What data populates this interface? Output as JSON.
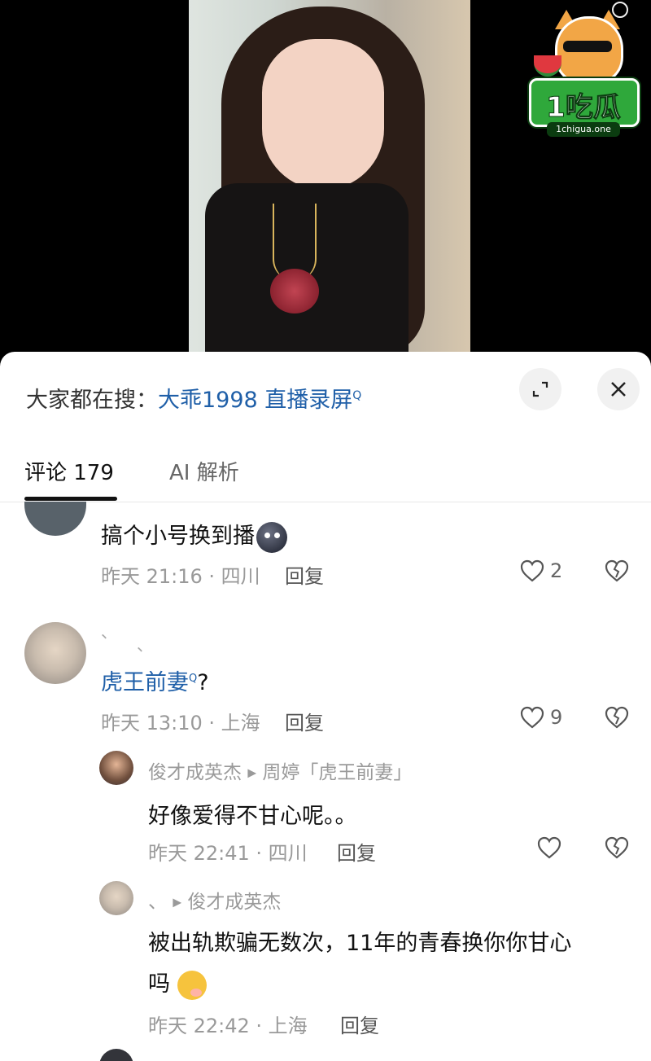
{
  "video": {},
  "watermark": {
    "logo_text": "1吃瓜",
    "site": "1chigua.one"
  },
  "search_bar": {
    "prefix": "大家都在搜：",
    "term": "大乖1998 直播录屏",
    "search_marker": "Q"
  },
  "tabs": [
    {
      "label": "评论 179",
      "active": true
    },
    {
      "label": "AI 解析",
      "active": false
    }
  ],
  "comments": [
    {
      "text": "搞个小号换到播",
      "meta": "昨天 21:16 · 四川",
      "reply": "回复",
      "likes": "2"
    },
    {
      "username": "、",
      "text_link": "虎王前妻",
      "search_marker": "Q",
      "text_suffix": "?",
      "meta": "昨天 13:10 · 上海",
      "reply": "回复",
      "likes": "9"
    },
    {
      "username": "俊才成英杰",
      "reply_to": "周婷「虎王前妻」",
      "text": "好像爱得不甘心呢。。",
      "meta": "昨天 22:41 · 四川",
      "reply": "回复"
    },
    {
      "username": "、",
      "reply_to": "俊才成英杰",
      "text_line1": "被出轨欺骗无数次，11年的青春换你你甘心",
      "text_line2": "吗",
      "meta": "昨天 22:42 · 上海",
      "reply": "回复"
    }
  ]
}
